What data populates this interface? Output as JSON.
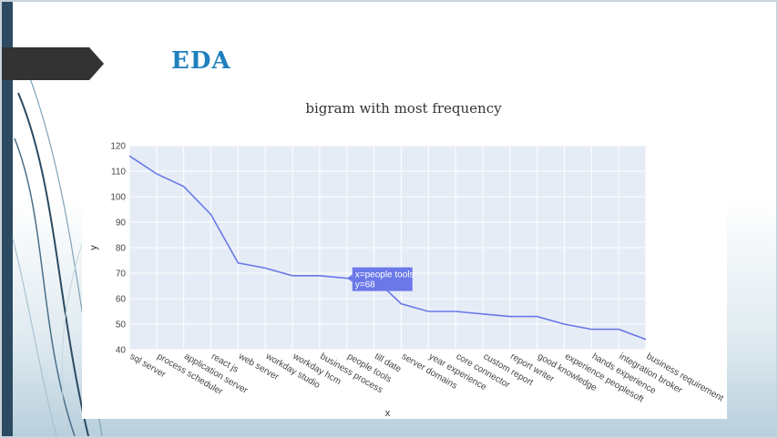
{
  "slide": {
    "title": "EDA"
  },
  "chart_data": {
    "type": "line",
    "title": "bigram with most frequency",
    "xlabel": "x",
    "ylabel": "y",
    "categories": [
      "sql server",
      "process scheduler",
      "application server",
      "react js",
      "web server",
      "workday studio",
      "workday hcm",
      "business process",
      "people tools",
      "till date",
      "server domains",
      "year experience",
      "core connector",
      "custom report",
      "report writer",
      "good knowledge",
      "experience peoplesoft",
      "hands experience",
      "integration broker",
      "business requirement"
    ],
    "values": [
      116,
      109,
      104,
      93,
      74,
      72,
      69,
      69,
      68,
      68,
      58,
      55,
      55,
      54,
      53,
      53,
      50,
      48,
      48,
      44
    ],
    "ylim": [
      40,
      120
    ],
    "yticks": [
      40,
      50,
      60,
      70,
      80,
      90,
      100,
      110,
      120
    ],
    "grid": true,
    "line_color": "#6a78e8",
    "plot_bg": "#e5ecf6",
    "hover": {
      "index": 8,
      "x_text": "x=people tools",
      "y_text": "y=68",
      "color": "#6a78e8"
    }
  }
}
